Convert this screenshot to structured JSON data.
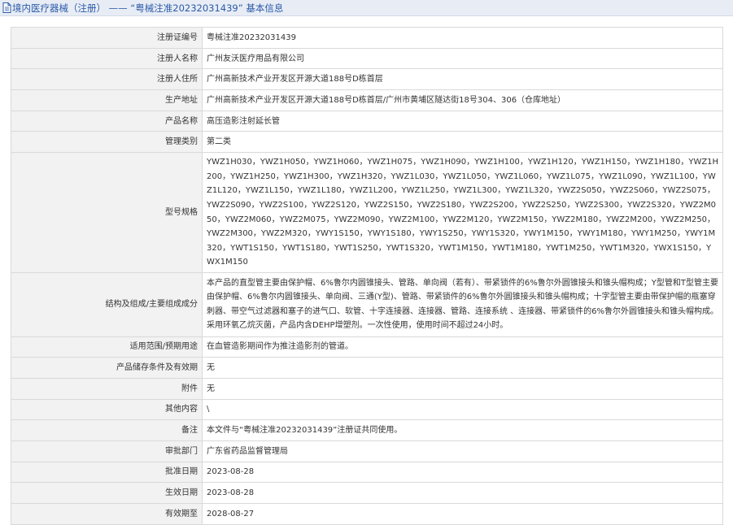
{
  "header": {
    "title": "境内医疗器械（注册）  ——  “粤械注准20232031439”  基本信息"
  },
  "rows": [
    {
      "label": "注册证编号",
      "value": "粤械注准20232031439"
    },
    {
      "label": "注册人名称",
      "value": "广州友沃医疗用品有限公司"
    },
    {
      "label": "注册人住所",
      "value": "广州高新技术产业开发区开源大道188号D栋首层"
    },
    {
      "label": "生产地址",
      "value": "广州高新技术产业开发区开源大道188号D栋首层/广州市黄埔区隧达街18号304、306（仓库地址）"
    },
    {
      "label": "产品名称",
      "value": "高压造影注射延长管"
    },
    {
      "label": "管理类别",
      "value": "第二类"
    },
    {
      "label": "型号规格",
      "value": "YWZ1H030，YWZ1H050，YWZ1H060，YWZ1H075，YWZ1H090，YWZ1H100，YWZ1H120，YWZ1H150，YWZ1H180，YWZ1H200，YWZ1H250，YWZ1H300，YWZ1H320，YWZ1L030，YWZ1L050，YWZ1L060，YWZ1L075，YWZ1L090，YWZ1L100，YWZ1L120，YWZ1L150，YWZ1L180，YWZ1L200，YWZ1L250，YWZ1L300，YWZ1L320，YWZ2S050，YWZ2S060，YWZ2S075，YWZ2S090，YWZ2S100，YWZ2S120，YWZ2S150，YWZ2S180，YWZ2S200，YWZ2S250，YWZ2S300，YWZ2S320，YWZ2M050，YWZ2M060，YWZ2M075，YWZ2M090，YWZ2M100，YWZ2M120，YWZ2M150，YWZ2M180，YWZ2M200，YWZ2M250，YWZ2M300，YWZ2M320，YWY1S150，YWY1S180，YWY1S250，YWY1S320，YWY1M150，YWY1M180，YWY1M250，YWY1M320，YWT1S150，YWT1S180，YWT1S250，YWT1S320，YWT1M150，YWT1M180，YWT1M250，YWT1M320，YWX1S150，YWX1M150"
    },
    {
      "label": "结构及组成/主要组成成分",
      "value": "本产品的直型管主要由保护帽、6%鲁尔内圆锥接头、管路、单向阀（若有）、带紧锁件的6%鲁尔外圆锥接头和锥头帽构成；Y型管和T型管主要由保护帽、6%鲁尔内圆锥接头、单向阀、三通(Y型)、管路、带紧锁件的6%鲁尔外圆锥接头和锥头帽构成；十字型管主要由带保护帽的瓶塞穿刺器、带空气过滤器和塞子的进气口、软管、十字连接器、连接器、管路、连接系统 、连接器、带紧锁件的6%鲁尔外圆锥接头和锥头帽构成。采用环氧乙烷灭菌，产品内含DEHP增塑剂。一次性使用，使用时间不超过24小时。"
    },
    {
      "label": "适用范围/预期用途",
      "value": "在血管造影期间作为推注造影剂的管道。"
    },
    {
      "label": "产品储存条件及有效期",
      "value": "无"
    },
    {
      "label": "附件",
      "value": "无"
    },
    {
      "label": "其他内容",
      "value": "\\"
    },
    {
      "label": "备注",
      "value": "本文件与“粤械注准20232031439”注册证共同使用。"
    },
    {
      "label": "审批部门",
      "value": "广东省药品监督管理局"
    },
    {
      "label": "批准日期",
      "value": "2023-08-28"
    },
    {
      "label": "生效日期",
      "value": "2023-08-28"
    },
    {
      "label": "有效期至",
      "value": "2028-08-27"
    }
  ]
}
